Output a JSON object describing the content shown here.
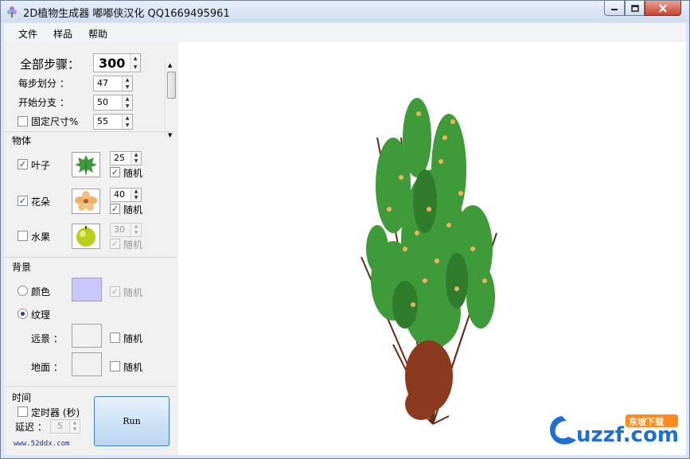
{
  "window": {
    "title": "2D植物生成器 嘟嘟侠汉化 QQ1669495961"
  },
  "menu": {
    "items": [
      "文件",
      "样品",
      "帮助"
    ]
  },
  "steps": {
    "total_label": "全部步骤：",
    "total_value": "300",
    "subdivide_label": "每步划分 ：",
    "subdivide_value": "47",
    "branch_label": "开始分支 ：",
    "branch_value": "50",
    "fixed_label": "固定尺寸%",
    "fixed_value": "55"
  },
  "objects": {
    "section_label": "物体",
    "leaf_label": "叶子",
    "leaf_value": "25",
    "flower_label": "花朵",
    "flower_value": "40",
    "fruit_label": "水果",
    "fruit_value": "30",
    "random_label": "随机"
  },
  "background": {
    "section_label": "背景",
    "color_label": "颜色",
    "texture_label": "纹理",
    "far_label": "远景 ：",
    "ground_label": "地面 ：",
    "random_label": "随机",
    "color_swatch": "#c8c8ff"
  },
  "time": {
    "section_label": "时间",
    "timer_label": "定时器 (秒)",
    "delay_label": "延迟 ：",
    "delay_value": "5"
  },
  "run_label": "Run",
  "site_text": "www.52ddx.com",
  "watermark": {
    "main": "uzzf.com",
    "badge": "东坡下载"
  }
}
